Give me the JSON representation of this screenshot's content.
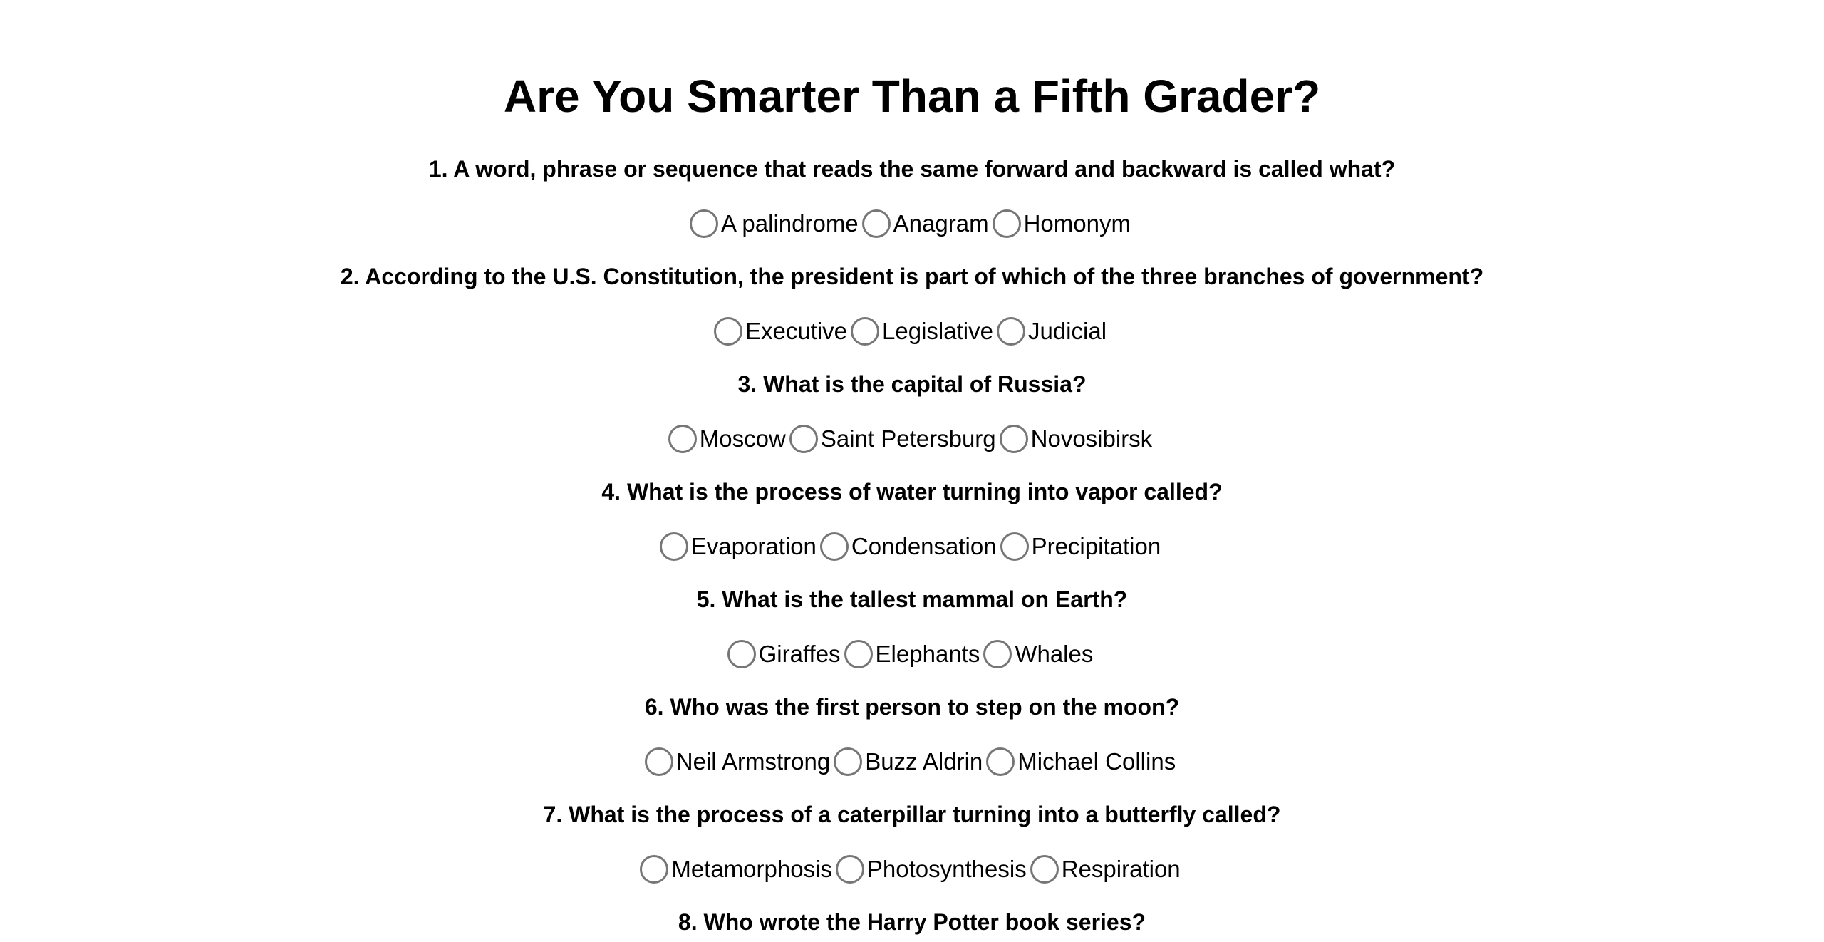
{
  "title": "Are You Smarter Than a Fifth Grader?",
  "questions": [
    {
      "text": "1. A word, phrase or sequence that reads the same forward and backward is called what?",
      "options": [
        "A palindrome",
        "Anagram",
        "Homonym"
      ]
    },
    {
      "text": "2. According to the U.S. Constitution, the president is part of which of the three branches of government?",
      "options": [
        "Executive",
        "Legislative",
        "Judicial"
      ]
    },
    {
      "text": "3. What is the capital of Russia?",
      "options": [
        "Moscow",
        "Saint Petersburg",
        "Novosibirsk"
      ]
    },
    {
      "text": "4. What is the process of water turning into vapor called?",
      "options": [
        "Evaporation",
        "Condensation",
        "Precipitation"
      ]
    },
    {
      "text": "5. What is the tallest mammal on Earth?",
      "options": [
        "Giraffes",
        "Elephants",
        "Whales"
      ]
    },
    {
      "text": "6. Who was the first person to step on the moon?",
      "options": [
        "Neil Armstrong",
        "Buzz Aldrin",
        "Michael Collins"
      ]
    },
    {
      "text": "7. What is the process of a caterpillar turning into a butterfly called?",
      "options": [
        "Metamorphosis",
        "Photosynthesis",
        "Respiration"
      ]
    },
    {
      "text": "8. Who wrote the Harry Potter book series?",
      "options": []
    }
  ]
}
